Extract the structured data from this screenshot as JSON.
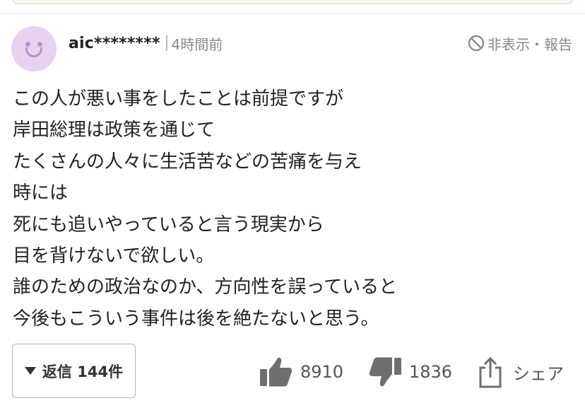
{
  "comment": {
    "username": "aic********",
    "timestamp": "4時間前",
    "report_label": "非表示・報告",
    "body_lines": [
      "この人が悪い事をしたことは前提ですが",
      "岸田総理は政策を通じて",
      "たくさんの人々に生活苦などの苦痛を与え",
      "時には",
      "死にも追いやっていると言う現実から",
      "目を背けないで欲しい。",
      "誰のための政治なのか、方向性を誤っていると",
      "今後もこういう事件は後を絶たないと思う。"
    ],
    "reply_button_label": "返信 144件",
    "like_count": "8910",
    "dislike_count": "1836",
    "share_label": "シェア"
  },
  "icons": {
    "avatar": "smiley-avatar-icon",
    "report": "ban-icon",
    "reply_toggle": "caret-down-icon",
    "like": "thumbs-up-icon",
    "dislike": "thumbs-down-icon",
    "share": "share-icon"
  },
  "colors": {
    "avatar_bg": "#e7d2ef",
    "avatar_face": "#b88fcd",
    "text": "#222222",
    "muted": "#8a8a8a",
    "icon_gray": "#6e6e6e"
  }
}
